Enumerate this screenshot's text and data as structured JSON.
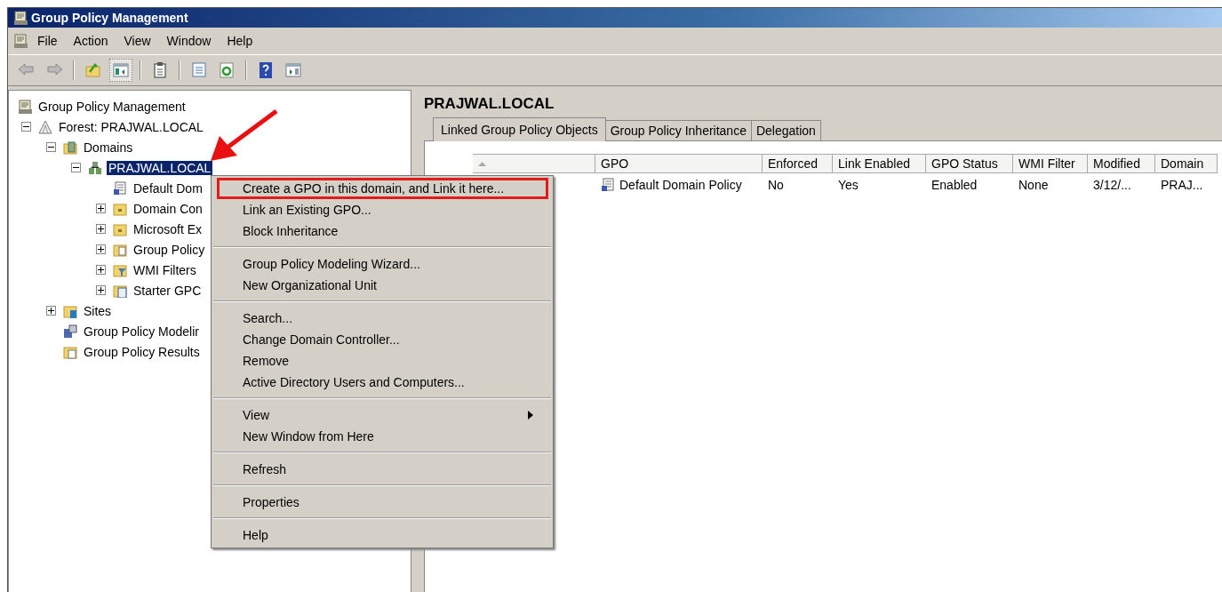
{
  "window": {
    "title": "Group Policy Management"
  },
  "menu_bar": [
    "File",
    "Action",
    "View",
    "Window",
    "Help"
  ],
  "toolbar": [
    {
      "kind": "back"
    },
    {
      "kind": "forward"
    },
    {
      "kind": "sep"
    },
    {
      "kind": "up"
    },
    {
      "kind": "tree",
      "selected": true
    },
    {
      "kind": "sep"
    },
    {
      "kind": "clipboard"
    },
    {
      "kind": "sep"
    },
    {
      "kind": "properties"
    },
    {
      "kind": "refresh"
    },
    {
      "kind": "sep"
    },
    {
      "kind": "help"
    },
    {
      "kind": "pane"
    }
  ],
  "tree": {
    "label": "Group Policy Management",
    "kind": "root",
    "selected": false,
    "children": [
      {
        "label": "Forest: PRAJWAL.LOCAL",
        "kind": "forest",
        "selected": false,
        "expanded": true,
        "children": [
          {
            "label": "Domains",
            "kind": "domains",
            "selected": false,
            "expanded": true,
            "children": [
              {
                "label": "PRAJWAL.LOCAL",
                "kind": "domain",
                "selected": true,
                "expanded": true,
                "children": [
                  {
                    "label": "Default Dom",
                    "kind": "gpo",
                    "selected": false
                  },
                  {
                    "label": "Domain Con",
                    "kind": "ou",
                    "selected": false,
                    "expanded": false
                  },
                  {
                    "label": "Microsoft Ex",
                    "kind": "ou",
                    "selected": false,
                    "expanded": false
                  },
                  {
                    "label": "Group Policy",
                    "kind": "gpofolder",
                    "selected": false,
                    "expanded": false
                  },
                  {
                    "label": "WMI Filters",
                    "kind": "wmi",
                    "selected": false,
                    "expanded": false
                  },
                  {
                    "label": "Starter GPC",
                    "kind": "starter",
                    "selected": false,
                    "expanded": false
                  }
                ]
              }
            ]
          },
          {
            "label": "Sites",
            "kind": "sites",
            "selected": false,
            "expanded": false
          },
          {
            "label": "Group Policy Modelir",
            "kind": "modeling",
            "selected": false
          },
          {
            "label": "Group Policy Results",
            "kind": "results",
            "selected": false
          }
        ]
      }
    ]
  },
  "details": {
    "heading": "PRAJWAL.LOCAL",
    "tabs": [
      {
        "label": "Linked Group Policy Objects",
        "selected": true
      },
      {
        "label": "Group Policy Inheritance",
        "selected": false
      },
      {
        "label": "Delegation",
        "selected": false
      }
    ],
    "table": {
      "columns": [
        {
          "sorted": true
        },
        {
          "label": "GPO",
          "sorted": false
        },
        {
          "label": "Enforced",
          "sorted": false
        },
        {
          "label": "Link Enabled",
          "sorted": false
        },
        {
          "label": "GPO Status",
          "sorted": false
        },
        {
          "label": "WMI Filter",
          "sorted": false
        },
        {
          "label": "Modified",
          "sorted": false
        },
        {
          "label": "Domain",
          "sorted": false
        }
      ],
      "rows": [
        {
          "cells": [
            "",
            "Default Domain Policy",
            "No",
            "Yes",
            "Enabled",
            "None",
            "3/12/...",
            "PRAJ..."
          ]
        }
      ]
    }
  },
  "context_menu": {
    "groups": [
      [
        {
          "label": "Create a GPO in this domain, and Link it here...",
          "highlighted": true
        },
        {
          "label": "Link an Existing GPO...",
          "highlighted": false
        },
        {
          "label": "Block Inheritance",
          "highlighted": false
        }
      ],
      [
        {
          "label": "Group Policy Modeling Wizard...",
          "highlighted": false
        },
        {
          "label": "New Organizational Unit",
          "highlighted": false
        }
      ],
      [
        {
          "label": "Search...",
          "highlighted": false
        },
        {
          "label": "Change Domain Controller...",
          "highlighted": false
        },
        {
          "label": "Remove",
          "highlighted": false
        },
        {
          "label": "Active Directory Users and Computers...",
          "highlighted": false
        }
      ],
      [
        {
          "label": "View",
          "highlighted": false,
          "submenu": true
        },
        {
          "label": "New Window from Here",
          "highlighted": false
        }
      ],
      [
        {
          "label": "Refresh",
          "highlighted": false
        }
      ],
      [
        {
          "label": "Properties",
          "highlighted": false
        }
      ],
      [
        {
          "label": "Help",
          "highlighted": false
        }
      ]
    ]
  },
  "annotation": {
    "kind": "arrow"
  }
}
